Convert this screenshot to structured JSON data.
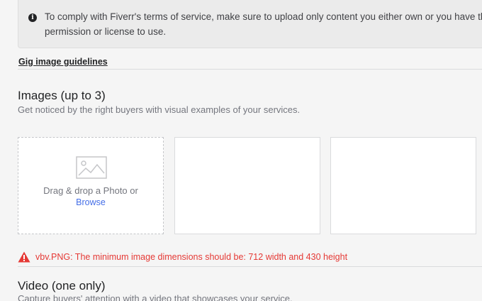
{
  "notice": {
    "icon": "info-icon",
    "text": "To comply with Fiverr's terms of service, make sure to upload only content you either own or you have the permission or license to use."
  },
  "guidelines_link": "Gig image guidelines",
  "images_section": {
    "title": "Images (up to 3)",
    "subtitle": "Get noticed by the right buyers with visual examples of your services.",
    "dropzone": {
      "icon": "image-placeholder-icon",
      "drop_text": "Drag & drop a Photo or",
      "browse_label": "Browse"
    },
    "slot_count": 3
  },
  "error": {
    "icon": "warning-icon",
    "message": "vbv.PNG: The minimum image dimensions should be: 712 width and 430 height",
    "color": "#e53935"
  },
  "video_section": {
    "title": "Video (one only)",
    "subtitle": "Capture buyers' attention with a video that showcases your service."
  },
  "colors": {
    "background": "#f5f5f5",
    "link": "#446ee7",
    "error": "#e53935"
  }
}
